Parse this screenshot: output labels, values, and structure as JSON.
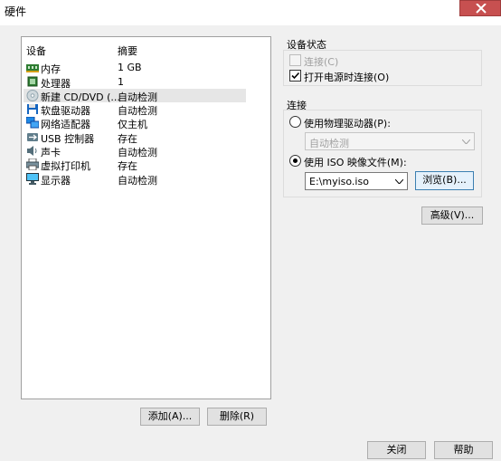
{
  "window": {
    "title": "硬件"
  },
  "device_list": {
    "columns": {
      "device": "设备",
      "summary": "摘要"
    },
    "items": [
      {
        "name": "内存",
        "summary": "1 GB"
      },
      {
        "name": "处理器",
        "summary": "1"
      },
      {
        "name": "新建 CD/DVD (...",
        "summary": "自动检测"
      },
      {
        "name": "软盘驱动器",
        "summary": "自动检测"
      },
      {
        "name": "网络适配器",
        "summary": "仅主机"
      },
      {
        "name": "USB 控制器",
        "summary": "存在"
      },
      {
        "name": "声卡",
        "summary": "自动检测"
      },
      {
        "name": "虚拟打印机",
        "summary": "存在"
      },
      {
        "name": "显示器",
        "summary": "自动检测"
      }
    ],
    "selected_index": 2
  },
  "buttons": {
    "add": "添加(A)...",
    "remove": "删除(R)",
    "advanced": "高级(V)...",
    "close": "关闭",
    "help": "帮助"
  },
  "device_status": {
    "label": "设备状态",
    "connected_label": "连接(C)",
    "connected_checked": false,
    "connected_enabled": false,
    "power_on_label": "打开电源时连接(O)",
    "power_on_checked": true
  },
  "connection": {
    "label": "连接",
    "physical_drive_label": "使用物理驱动器(P):",
    "physical_drive_value": "自动检测",
    "iso_label": "使用 ISO 映像文件(M):",
    "iso_value": "E:\\myiso.iso",
    "browse_label": "浏览(B)...",
    "selected": "iso"
  }
}
